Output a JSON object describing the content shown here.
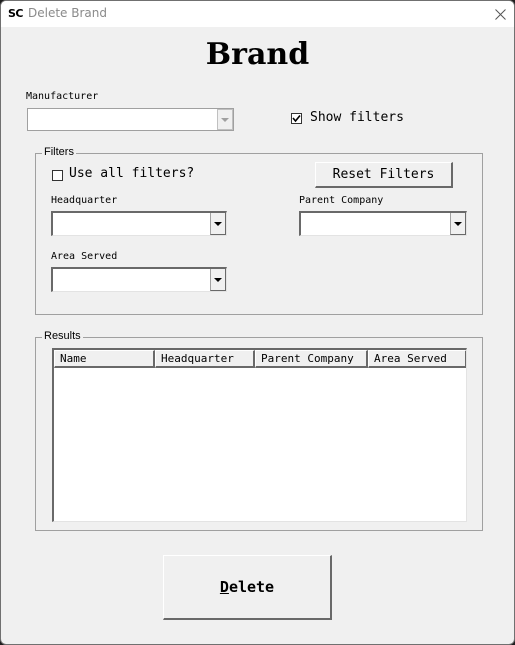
{
  "window": {
    "app_icon": "SC",
    "title": "Delete Brand",
    "close_icon": "close-icon"
  },
  "heading": "Brand",
  "manufacturer": {
    "label": "Manufacturer",
    "value": ""
  },
  "show_filters": {
    "label": "Show filters",
    "checked": true
  },
  "filters": {
    "group_title": "Filters",
    "use_all_label": "Use all filters?",
    "use_all_checked": false,
    "reset_button": "Reset Filters",
    "headquarter_label": "Headquarter",
    "headquarter_value": "",
    "parent_company_label": "Parent Company",
    "parent_company_value": "",
    "area_served_label": "Area Served",
    "area_served_value": ""
  },
  "results": {
    "group_title": "Results",
    "columns": [
      "Name",
      "Headquarter",
      "Parent Company",
      "Area Served"
    ],
    "rows": []
  },
  "delete_button": {
    "mnemonic": "D",
    "rest": "elete"
  }
}
